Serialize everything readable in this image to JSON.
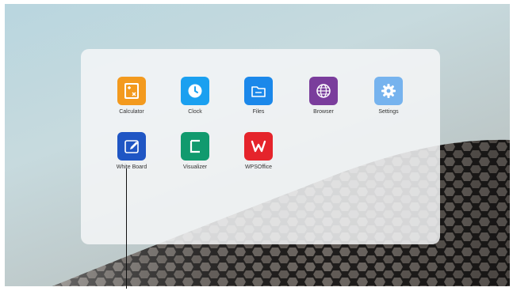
{
  "apps": [
    {
      "label": "Calculator",
      "icon": "calculator-icon",
      "color": "#f39a1e"
    },
    {
      "label": "Clock",
      "icon": "clock-icon",
      "color": "#1aa0f0"
    },
    {
      "label": "Files",
      "icon": "folder-icon",
      "color": "#1b88ea"
    },
    {
      "label": "Browser",
      "icon": "globe-icon",
      "color": "#7a3d9c"
    },
    {
      "label": "Settings",
      "icon": "gear-icon",
      "color": "#76b3ee"
    },
    {
      "label": "White Board",
      "icon": "whiteboard-pen-icon",
      "color": "#1f56c4"
    },
    {
      "label": "Visualizer",
      "icon": "visualizer-icon",
      "color": "#119a6e"
    },
    {
      "label": "WPSOffice",
      "icon": "wps-office-icon",
      "color": "#e5242b"
    }
  ]
}
